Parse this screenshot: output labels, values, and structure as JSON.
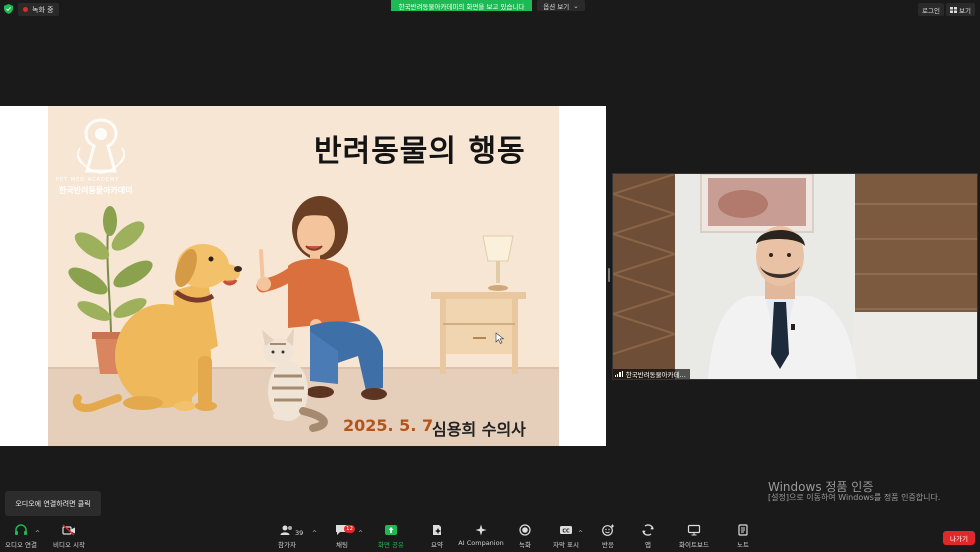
{
  "top_bar": {
    "recording_label": "녹화 중",
    "share_banner": "한국반려동물아카데미의 화면을 보고 있습니다",
    "view_options_label": "옵션 보기",
    "login_label": "로그인",
    "view_label": "보기"
  },
  "slide": {
    "logo_subtitle": "PET  MED  ACADEMY",
    "logo_name": "한국반려동물아카데미",
    "title": "반려동물의 행동",
    "date": "2025. 5. 7",
    "presenter": "심용희 수의사"
  },
  "video": {
    "participant_name": "한국반려동물아카데..."
  },
  "windows_watermark": {
    "title": "Windows 정품 인증",
    "subtitle": "[설정]으로 이동하여 Windows를 정품 인증합니다."
  },
  "tooltip": {
    "text": "오디오에 연결하려면 클릭"
  },
  "toolbar": {
    "audio": "오디오 연결",
    "video": "비디오 시작",
    "participants": "참가자",
    "participants_count": "39",
    "chat": "채팅",
    "chat_badge": "12",
    "share": "화면 공유",
    "summary": "요약",
    "ai_companion": "AI Companion",
    "record": "녹화",
    "captions": "자막 표시",
    "reactions": "반응",
    "apps": "앱",
    "whiteboard": "화이트보드",
    "notes": "노트",
    "leave": "나가기"
  },
  "colors": {
    "share_green": "#1db954",
    "leave_red": "#e02828",
    "slide_bg": "#f7e6d4",
    "slide_accent": "#b3541e"
  }
}
